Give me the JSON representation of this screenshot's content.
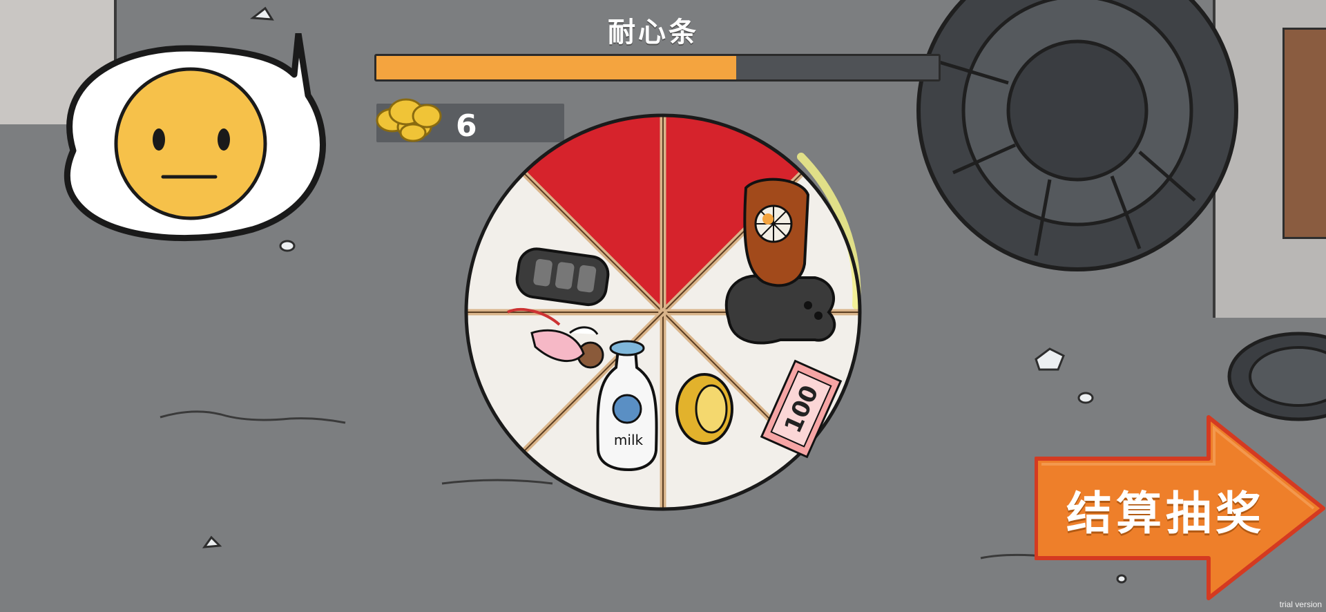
{
  "hud": {
    "patience_label": "耐心条",
    "patience_level": 0.64,
    "coin_count": "6"
  },
  "emotion": {
    "state": "neutral",
    "icon": "neutral-face-icon"
  },
  "wheel": {
    "segments": [
      {
        "item": "car-key-icon",
        "color": "#f2efea"
      },
      {
        "item": "red-segment",
        "color": "#d6232c"
      },
      {
        "item": "red-segment",
        "color": "#d6232c"
      },
      {
        "item": "glove-and-gamepad-icon",
        "color": "#f2efea"
      },
      {
        "item": "banknote-100-icon",
        "color": "#f2efea",
        "label": "100"
      },
      {
        "item": "gold-ring-icon",
        "color": "#f2efea"
      },
      {
        "item": "milk-bottle-icon",
        "color": "#f2efea",
        "label": "milk"
      },
      {
        "item": "angel-doll-icon",
        "color": "#f2efea"
      }
    ],
    "highlight_color": "#f2f08a"
  },
  "settle_button": {
    "label": "结算抽奖",
    "color": "#ee7f2a"
  },
  "watermark": "trial version"
}
